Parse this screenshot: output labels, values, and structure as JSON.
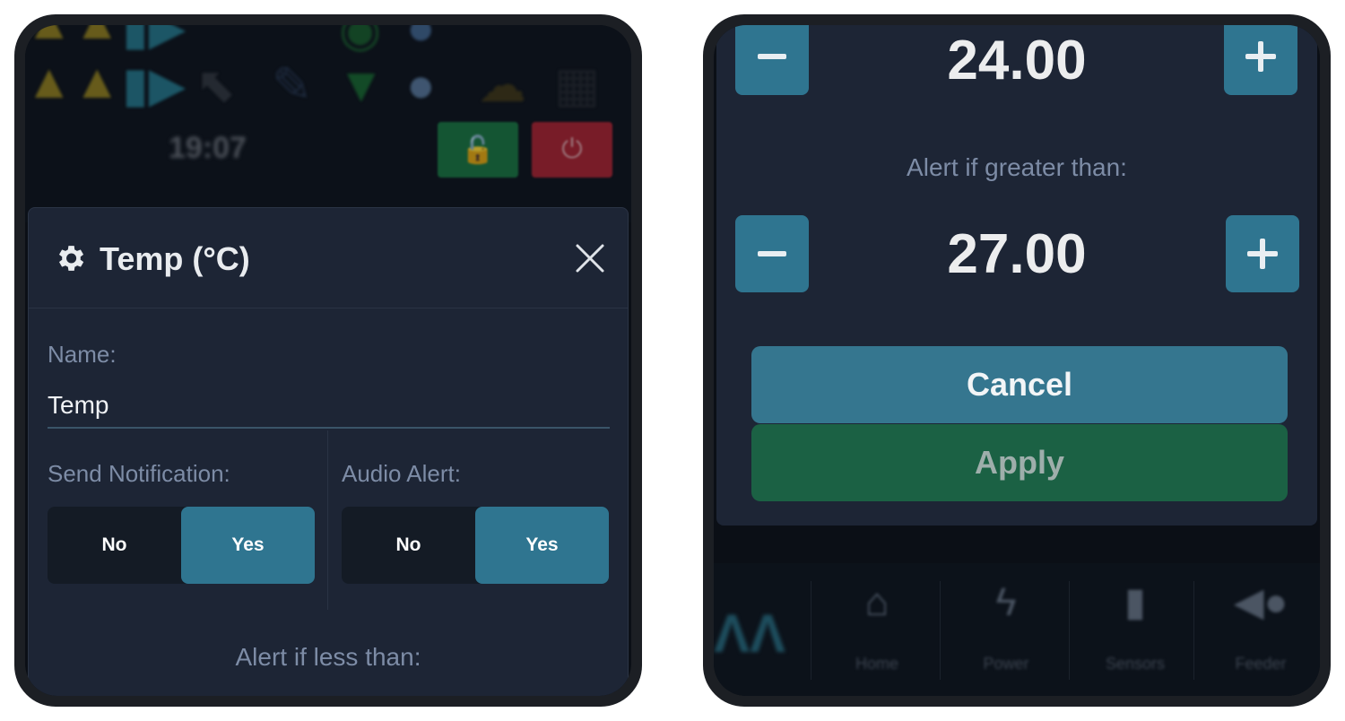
{
  "left_panel": {
    "background": {
      "time": "19:07",
      "icons": [
        "warning-icon",
        "play-icon",
        "cursor-icon",
        "pen-icon",
        "wifi-icon",
        "globe-icon",
        "cloud-icon",
        "calendar-icon"
      ],
      "unlock_icon": "lock-open-icon",
      "power_icon": "power-icon"
    },
    "modal": {
      "title": "Temp (°C)",
      "title_icon": "gear-icon",
      "close_icon": "close-icon",
      "name_label": "Name:",
      "name_value": "Temp",
      "send_notification": {
        "label": "Send Notification:",
        "options": [
          "No",
          "Yes"
        ],
        "selected": "Yes"
      },
      "audio_alert": {
        "label": "Audio Alert:",
        "options": [
          "No",
          "Yes"
        ],
        "selected": "Yes"
      },
      "alert_less_label": "Alert if less than:"
    }
  },
  "right_panel": {
    "alert_less_value": "24.00",
    "alert_greater_label": "Alert if greater than:",
    "alert_greater_value": "27.00",
    "cancel_label": "Cancel",
    "apply_label": "Apply",
    "nav": [
      {
        "label": "Home",
        "icon": "home-icon"
      },
      {
        "label": "Power",
        "icon": "bolt-icon"
      },
      {
        "label": "Sensors",
        "icon": "thermometer-icon"
      },
      {
        "label": "Feeder",
        "icon": "fish-icon"
      }
    ]
  },
  "colors": {
    "accent": "#2f7590",
    "apply": "#1b6144",
    "modal_bg": "#1d2535",
    "label": "#7d8ca6"
  }
}
